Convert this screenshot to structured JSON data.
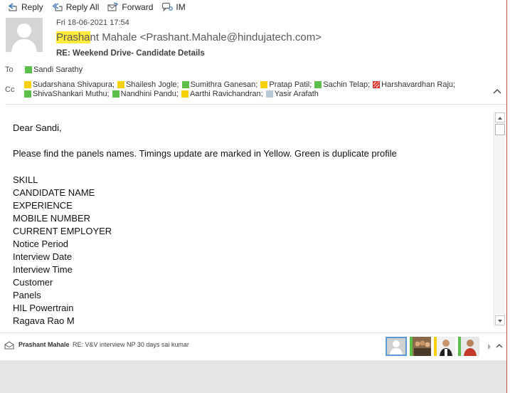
{
  "toolbar": {
    "reply": "Reply",
    "reply_all": "Reply All",
    "forward": "Forward",
    "im": "IM"
  },
  "header": {
    "date": "Fri 18-06-2021 17:54",
    "from_highlight": "Prasha",
    "from_rest": "nt Mahale <Prashant.Mahale@hindujatech.com>",
    "subject": "RE: Weekend Drive- Candidate Details",
    "to_label": "To",
    "cc_label": "Cc",
    "to": [
      {
        "name": "Sandi Sarathy",
        "status": "green"
      }
    ],
    "cc_line1": [
      {
        "name": "Sudarshana Shivapura;",
        "status": "yellow"
      },
      {
        "name": "Shailesh Jogle;",
        "status": "yellow"
      },
      {
        "name": "Sumithra Ganesan;",
        "status": "green"
      },
      {
        "name": "Pratap Patil;",
        "status": "yellow"
      },
      {
        "name": "Sachin Telap;",
        "status": "green"
      },
      {
        "name": "Harshavardhan Raju;",
        "status": "red"
      }
    ],
    "cc_line2": [
      {
        "name": "ShivaShankari Muthu;",
        "status": "green"
      },
      {
        "name": "Nandhini Pandu;",
        "status": "green"
      },
      {
        "name": "Aarthi Ravichandran;",
        "status": "yellow"
      },
      {
        "name": "Yasir Arafath",
        "status": "gray"
      }
    ]
  },
  "body": {
    "greeting": "Dear Sandi,",
    "message": "Please find the panels names. Timings update are marked in Yellow. Green is duplicate profile",
    "lines": [
      "SKILL",
      "CANDIDATE NAME",
      "EXPERIENCE",
      "MOBILE NUMBER",
      "CURRENT EMPLOYER",
      "Notice Period",
      "Interview Date",
      "Interview Time",
      "Customer",
      "Panels",
      "HIL Powertrain",
      "Ragava Rao M"
    ]
  },
  "people_bar": {
    "name": "Prashant Mahale",
    "message": "RE: V&V interview NP 30 days sai kumar"
  },
  "colors": {
    "presence_green": "#5cbf4a",
    "presence_yellow": "#f7d008",
    "presence_red": "#e0302a",
    "highlight": "#ffeb3b"
  }
}
